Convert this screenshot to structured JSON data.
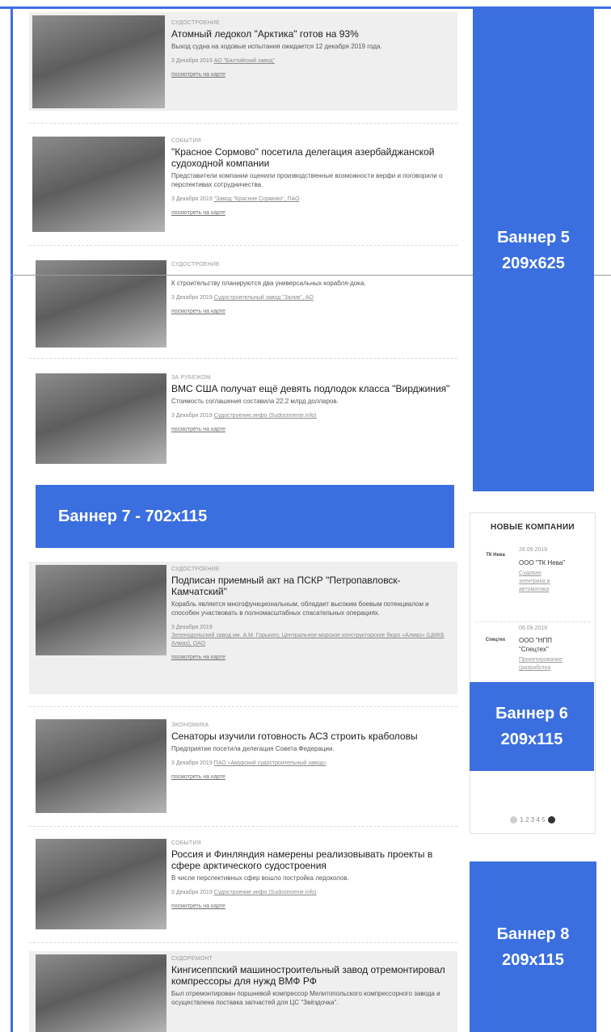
{
  "news": [
    {
      "category": "СУДОСТРОЕНИЕ",
      "title": "Атомный ледокол \"Арктика\" готов на 93%",
      "description": "Выход судна на ходовые испытания ожидается 12 декабря 2019 года.",
      "date": "3 Декабря 2019",
      "source": "АО \"Балтийский завод\"",
      "map_link": "посмотреть на карте"
    },
    {
      "category": "СОБЫТИЯ",
      "title": "\"Красное Сормово\" посетила делегация азербайджанской судоходной компании",
      "description": "Представители компании оценили производственные возможности верфи и поговорили о перспективах сотрудничества.",
      "date": "3 Декабря 2019",
      "source": "\"Завод \"Красное Сормово\", ПАО",
      "map_link": "посмотреть на карте"
    },
    {
      "category": "СУДОСТРОЕНИЕ",
      "title": "",
      "description": "К строительству планируются два универсальных корабля-дока.",
      "date": "3 Декабря 2019",
      "source": "Судостроительный завод \"Залив\", АО",
      "map_link": "посмотреть на карте"
    },
    {
      "category": "ЗА РУБЕЖОМ",
      "title": "ВМС США получат ещё девять подлодок класса \"Вирджиния\"",
      "description": "Стоимость соглашения составила 22,2 млрд долларов.",
      "date": "3 Декабря 2019",
      "source": "Судостроение.инфо (Sudostroenie.info)",
      "map_link": "посмотреть на карте"
    },
    {
      "category": "СУДОСТРОЕНИЕ",
      "title": "Подписан приемный акт на ПСКР \"Петропавловск-Камчатский\"",
      "description": "Корабль является многофункциональным, обладает высоким боевым потенциалом и способен участвовать в полномасштабных спасательных операциях.",
      "date": "3 Декабря 2019",
      "source": "Зеленодольский завод им. А.М. Горького, Центральное морское конструкторское бюро «Алмаз» (ЦМКБ Алмаз), ОАО",
      "map_link": "посмотреть на карте"
    },
    {
      "category": "ЭКОНОМИКА",
      "title": "Сенаторы изучили готовность АСЗ строить краболовы",
      "description": "Предприятие посетила делегация Совета Федерации.",
      "date": "3 Декабря 2019",
      "source": "ПАО «Амурский судостроительный завод»",
      "map_link": "посмотреть на карте"
    },
    {
      "category": "СОБЫТИЯ",
      "title": "Россия и Финляндия намерены реализовывать проекты в сфере арктического судостроения",
      "description": "В числе перспективных сфер вошло постройка ледоколов.",
      "date": "3 Декабря 2019",
      "source": "Судостроение.инфо (Sudostroenie.info)",
      "map_link": "посмотреть на карте"
    },
    {
      "category": "СУДОРЕМОНТ",
      "title": "Кингисеппский машиностроительный завод отремонтировал компрессоры для нужд ВМФ РФ",
      "description": "Был отремонтирован поршневой компрессор Мелитопольского компрессорного завода и осуществлена поставка запчастей для ЦС \"Звёздочка\".",
      "date": "",
      "source": "",
      "map_link": ""
    }
  ],
  "banners": {
    "b5": {
      "line1": "Баннер 5",
      "line2": "209x625"
    },
    "b6": {
      "line1": "Баннер 6",
      "line2": "209x115"
    },
    "b7": {
      "text": "Баннер 7 - 702x115"
    },
    "b8": {
      "line1": "Баннер 8",
      "line2": "209x115"
    }
  },
  "new_companies": {
    "heading": "НОВЫЕ КОМПАНИИ",
    "items": [
      {
        "logo": "ТК Нева",
        "date": "28.09.2019",
        "name": "ООО \"ТК Нева\"",
        "sub1": "Судовая",
        "sub2": "электрика и",
        "sub3": "автоматика"
      },
      {
        "logo": "Спецтех",
        "date": "06.09.2019",
        "name": "ООО \"НПП",
        "name2": "\"Спецтех\"",
        "sub1": "Проектирование",
        "sub2": "(разработка"
      }
    ],
    "pages": "1 2 3 4 5"
  },
  "colors": {
    "accent": "#3b6fe0",
    "frame": "#3d6fe0",
    "card_bg": "#efefef"
  }
}
